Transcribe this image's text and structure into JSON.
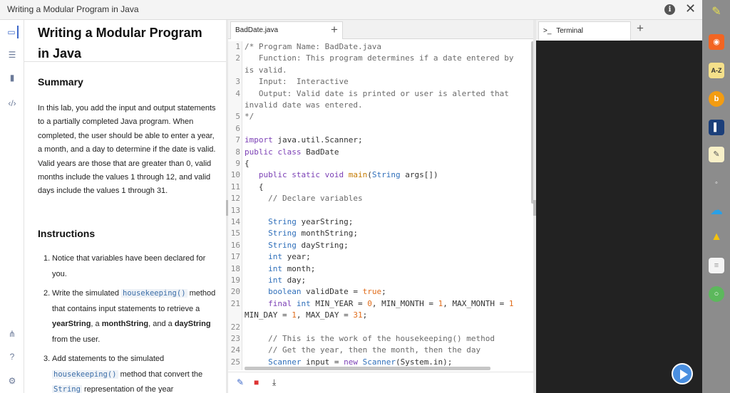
{
  "window": {
    "title": "Writing a Modular Program in Java"
  },
  "lab": {
    "title": "Writing a Modular Program in Java",
    "summary_heading": "Summary",
    "summary_text": "In this lab, you add the input and output statements to a partially completed Java program. When completed, the user should be able to enter a year, a month, and a day to determine if the date is valid. Valid years are those that are greater than 0, valid months include the values 1 through 12, and valid days include the values 1 through 31.",
    "instructions_heading": "Instructions",
    "steps": [
      {
        "num": "1.",
        "parts": [
          {
            "t": "Notice that variables have been declared for you."
          }
        ]
      },
      {
        "num": "2.",
        "parts": [
          {
            "t": "Write the simulated "
          },
          {
            "code": "housekeeping()"
          },
          {
            "t": " method that contains input statements to retrieve a "
          },
          {
            "b": "yearString"
          },
          {
            "t": ", a "
          },
          {
            "b": "monthString"
          },
          {
            "t": ", and a "
          },
          {
            "b": "dayString"
          },
          {
            "t": " from the user."
          }
        ]
      },
      {
        "num": "3.",
        "parts": [
          {
            "t": "Add statements to the simulated "
          },
          {
            "code": "housekeeping()"
          },
          {
            "t": " method that convert the "
          },
          {
            "code": "String"
          },
          {
            "t": " representation of the year"
          }
        ]
      }
    ]
  },
  "editor": {
    "tab": "BadDate.java",
    "plus": "+",
    "line_numbers": [
      "1",
      "2",
      "",
      "3",
      "4",
      "",
      "5",
      "6",
      "7",
      "8",
      "9",
      "10",
      "11",
      "12",
      "13",
      "14",
      "15",
      "16",
      "17",
      "18",
      "19",
      "20",
      "21",
      "",
      "22",
      "23",
      "24",
      "25"
    ],
    "lines": [
      [
        [
          "cm",
          "/* Program Name: BadDate.java"
        ]
      ],
      [
        [
          "cm",
          "   Function: This program determines if a date entered by"
        ]
      ],
      [
        [
          "cm",
          "is valid."
        ]
      ],
      [
        [
          "cm",
          "   Input:  Interactive"
        ]
      ],
      [
        [
          "cm",
          "   Output: Valid date is printed or user is alerted that"
        ]
      ],
      [
        [
          "cm",
          "invalid date was entered."
        ]
      ],
      [
        [
          "cm",
          "*/"
        ]
      ],
      [
        [
          "",
          ""
        ]
      ],
      [
        [
          "kw",
          "import"
        ],
        [
          "",
          " java.util.Scanner;"
        ]
      ],
      [
        [
          "kw",
          "public"
        ],
        [
          "",
          ""
        ],
        [
          "kw",
          " class"
        ],
        [
          "",
          " BadDate"
        ]
      ],
      [
        [
          "",
          "{"
        ]
      ],
      [
        [
          "",
          "   "
        ],
        [
          "kw",
          "public"
        ],
        [
          "kw",
          " static"
        ],
        [
          "kw",
          " void"
        ],
        [
          "fn",
          " main"
        ],
        [
          "",
          "("
        ],
        [
          "ty",
          "String"
        ],
        [
          "",
          " args[])"
        ]
      ],
      [
        [
          "",
          "   {"
        ]
      ],
      [
        [
          "",
          "     "
        ],
        [
          "cm",
          "// Declare variables"
        ]
      ],
      [
        [
          "",
          ""
        ]
      ],
      [
        [
          "",
          "     "
        ],
        [
          "ty",
          "String"
        ],
        [
          "",
          " yearString;"
        ]
      ],
      [
        [
          "",
          "     "
        ],
        [
          "ty",
          "String"
        ],
        [
          "",
          " monthString;"
        ]
      ],
      [
        [
          "",
          "     "
        ],
        [
          "ty",
          "String"
        ],
        [
          "",
          " dayString;"
        ]
      ],
      [
        [
          "",
          "     "
        ],
        [
          "ty",
          "int"
        ],
        [
          "",
          " year;"
        ]
      ],
      [
        [
          "",
          "     "
        ],
        [
          "ty",
          "int"
        ],
        [
          "",
          " month;"
        ]
      ],
      [
        [
          "",
          "     "
        ],
        [
          "ty",
          "int"
        ],
        [
          "",
          " day;"
        ]
      ],
      [
        [
          "",
          "     "
        ],
        [
          "ty",
          "boolean"
        ],
        [
          "",
          " validDate = "
        ],
        [
          "nu",
          "true"
        ],
        [
          "",
          ";"
        ]
      ],
      [
        [
          "",
          "     "
        ],
        [
          "kw",
          "final"
        ],
        [
          "ty",
          " int"
        ],
        [
          "",
          " MIN_YEAR = "
        ],
        [
          "nu",
          "0"
        ],
        [
          "",
          ", MIN_MONTH = "
        ],
        [
          "nu",
          "1"
        ],
        [
          "",
          ", MAX_MONTH = "
        ],
        [
          "nu",
          "1"
        ]
      ],
      [
        [
          "",
          "MIN_DAY = "
        ],
        [
          "nu",
          "1"
        ],
        [
          "",
          ", MAX_DAY = "
        ],
        [
          "nu",
          "31"
        ],
        [
          "",
          ";"
        ]
      ],
      [
        [
          "",
          ""
        ]
      ],
      [
        [
          "",
          "     "
        ],
        [
          "cm",
          "// This is the work of the housekeeping() method"
        ]
      ],
      [
        [
          "",
          "     "
        ],
        [
          "cm",
          "// Get the year, then the month, then the day"
        ]
      ],
      [
        [
          "",
          "     "
        ],
        [
          "ty",
          "Scanner"
        ],
        [
          "",
          " input = "
        ],
        [
          "kw",
          "new"
        ],
        [
          "ty",
          " Scanner"
        ],
        [
          "",
          "(System.in);"
        ]
      ]
    ]
  },
  "terminal": {
    "tab": "Terminal",
    "prompt_icon": ">_",
    "plus": "+"
  },
  "colors": {
    "terminal_bg": "#222222",
    "dock_bg": "#8c8c8c",
    "accent_blue": "#4a8fe0"
  }
}
